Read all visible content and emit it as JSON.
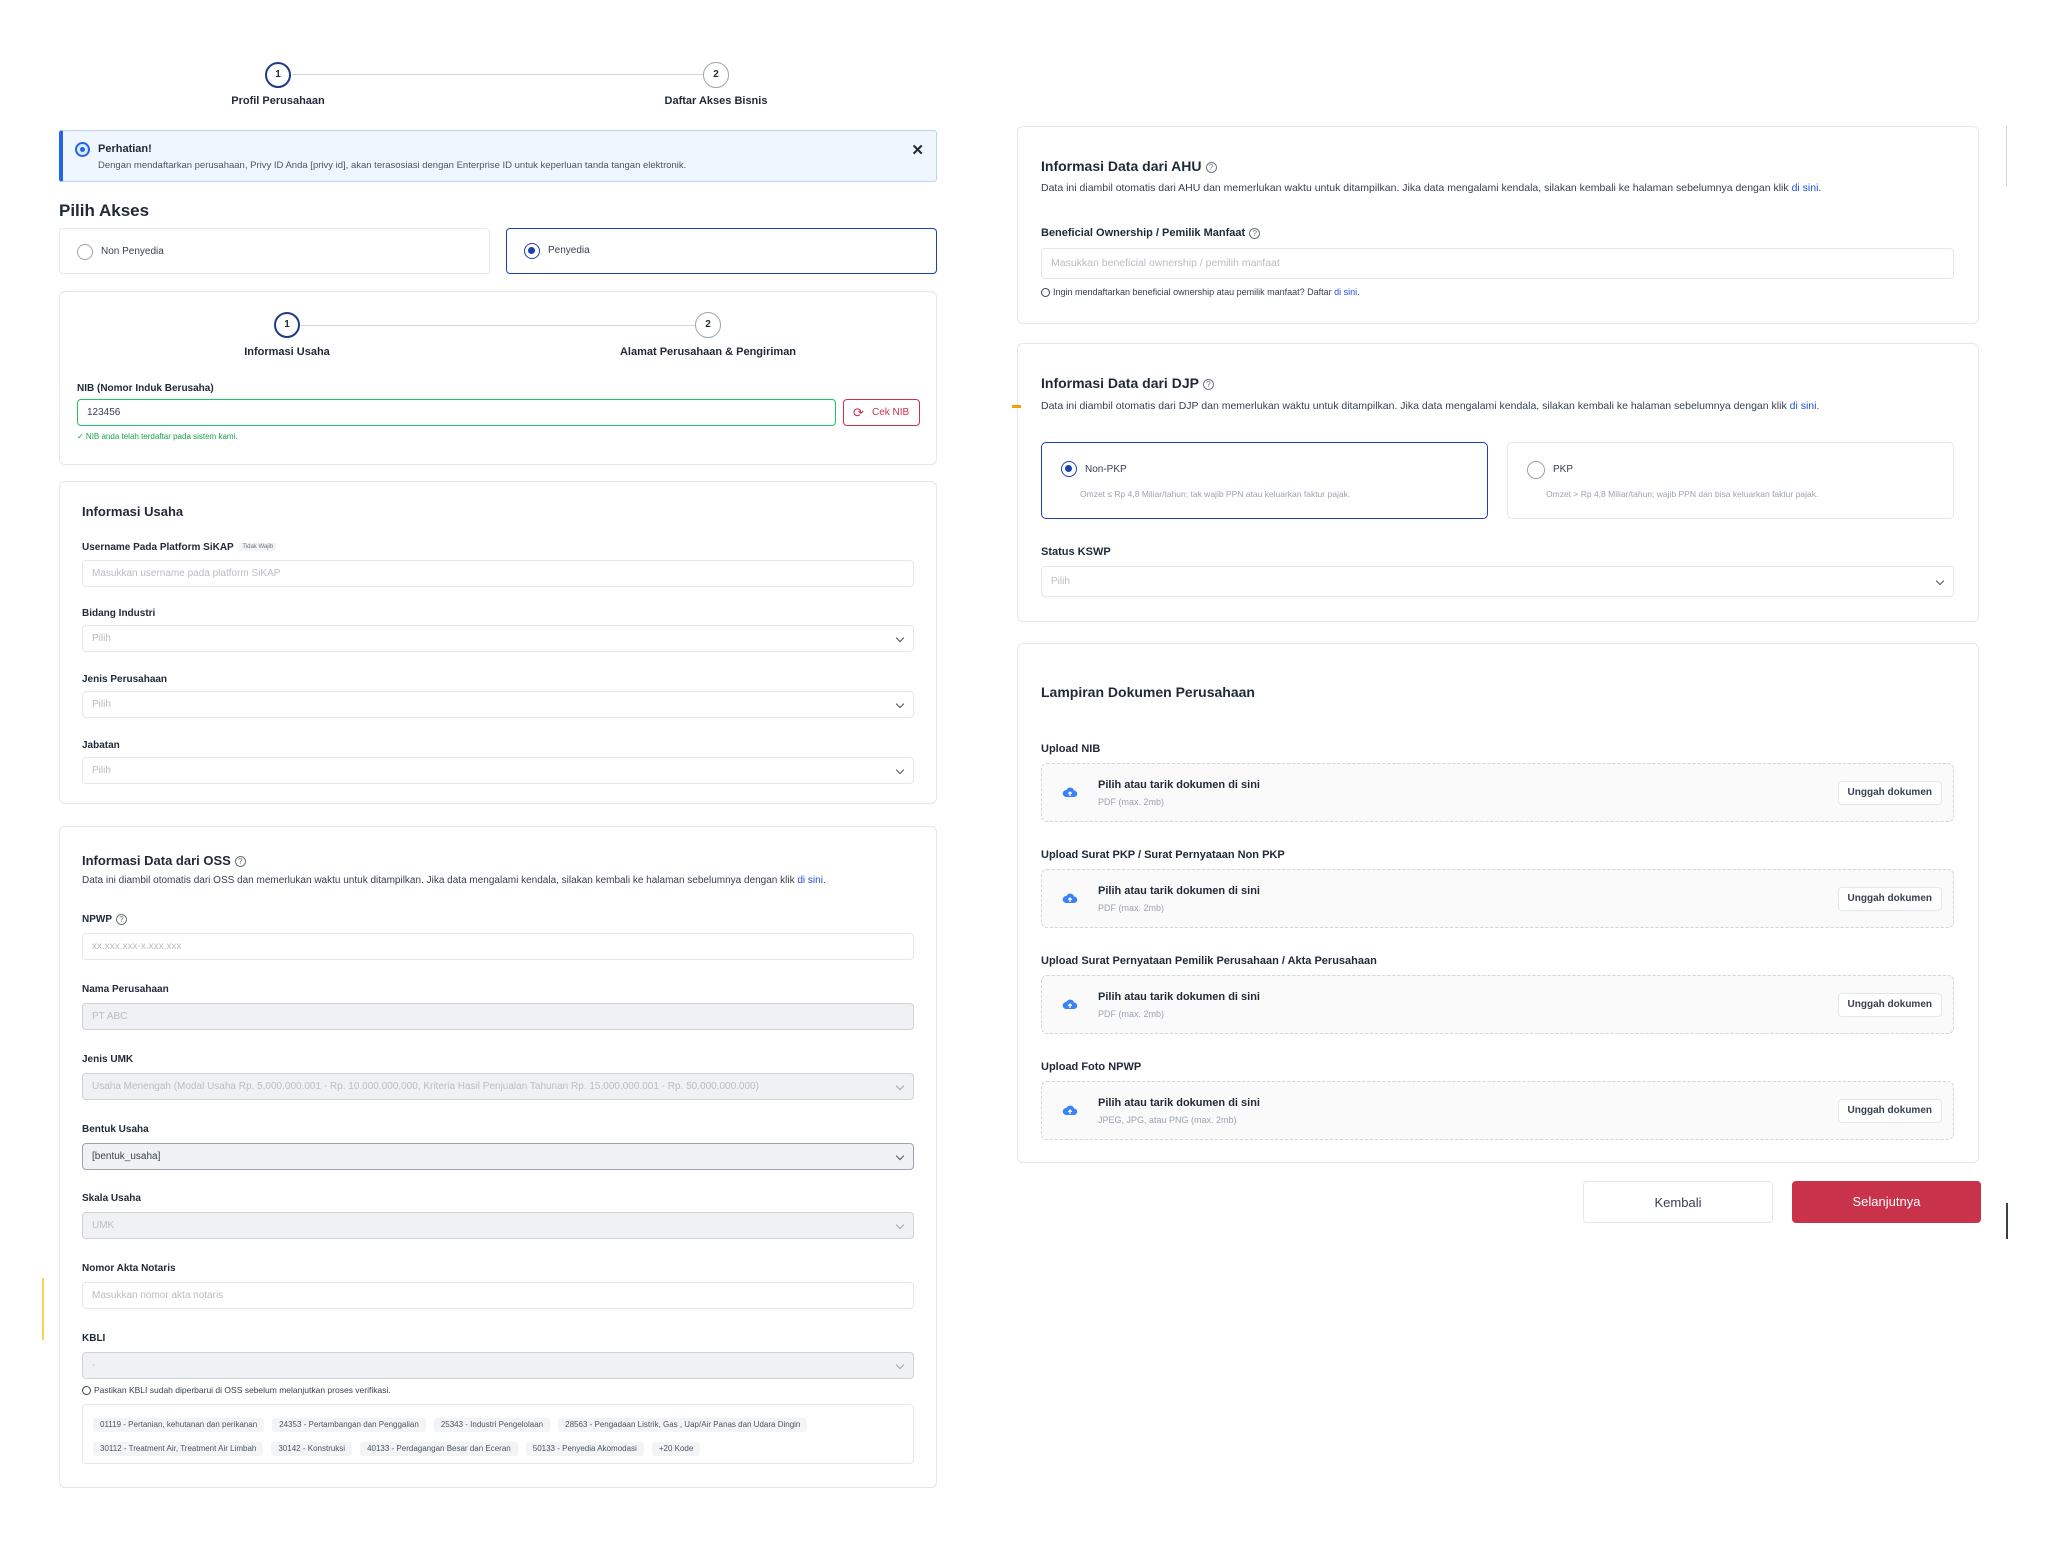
{
  "top_stepper": {
    "step1": "1",
    "step1_label": "Profil Perusahaan",
    "step2": "2",
    "step2_label": "Daftar Akses Bisnis"
  },
  "alert": {
    "title": "Perhatian!",
    "text": "Dengan mendaftarkan perusahaan, Privy ID Anda [privy id], akan terasosiasi dengan Enterprise ID untuk keperluan tanda tangan elektronik.",
    "close": "✕"
  },
  "access": {
    "title": "Pilih Akses",
    "option1": "Non Penyedia",
    "option2": "Penyedia",
    "selected": "Penyedia"
  },
  "inner_stepper": {
    "step1": "1",
    "step1_label": "Informasi Usaha",
    "step2": "2",
    "step2_label": "Alamat Perusahaan & Pengiriman"
  },
  "nib": {
    "label": "NIB (Nomor Induk Berusaha)",
    "value": "123456",
    "check_button": "Cek NIB",
    "success": "✓ NIB anda telah terdaftar pada sistem kami."
  },
  "usaha": {
    "title": "Informasi Usaha",
    "username_label": "Username Pada Platform SiKAP",
    "username_badge": "Tidak Wajib",
    "username_placeholder": "Masukkan username pada platform SiKAP",
    "bidang_label": "Bidang Industri",
    "bidang_placeholder": "Pilih",
    "jenis_label": "Jenis Perusahaan",
    "jenis_placeholder": "Pilih",
    "jabatan_label": "Jabatan",
    "jabatan_placeholder": "Pilih"
  },
  "oss": {
    "title": "Informasi Data dari OSS",
    "help": "?",
    "desc": "Data ini diambil otomatis dari OSS dan memerlukan waktu untuk ditampilkan. Jika data mengalami kendala, silakan kembali ke halaman sebelumnya dengan klik ",
    "desc_link": "di sini",
    "desc_end": ".",
    "npwp_label": "NPWP",
    "npwp_placeholder": "xx.xxx.xxx-x.xxx.xxx",
    "nama_label": "Nama Perusahaan",
    "nama_value": "PT ABC",
    "umk_label": "Jenis UMK",
    "umk_value": "Usaha Menengah (Modal Usaha Rp. 5.000.000.001 - Rp. 10.000.000.000, Kriteria Hasil Penjualan Tahunan Rp. 15.000.000.001 - Rp. 50.000.000.000)",
    "bentuk_label": "Bentuk Usaha",
    "bentuk_value": "[bentuk_usaha]",
    "skala_label": "Skala Usaha",
    "skala_value": "UMK",
    "akta_label": "Nomor Akta Notaris",
    "akta_placeholder": "Masukkan nomor akta notaris",
    "kbli_label": "KBLI",
    "kbli_value": "-",
    "kbli_note": "Pastikan KBLI sudah diperbarui di OSS sebelum melanjutkan proses verifikasi.",
    "kbli_chips": [
      "01119 - Pertanian, kehutanan dan perikanan",
      "24353 - Pertambangan dan Penggalian",
      "25343 - Industri Pengelolaan",
      "28563 - Pengadaan Listrik, Gas , Uap/Air Panas dan Udara Dingin",
      "30112 - Treatment Air, Treatment Air Limbah",
      "30142 - Konstruksi",
      "40133 - Perdagangan Besar dan Eceran",
      "50133 - Penyedia Akomodasi",
      "+20 Kode"
    ]
  },
  "ahu": {
    "title": "Informasi Data dari AHU",
    "desc": "Data ini diambil otomatis dari AHU dan memerlukan waktu untuk ditampilkan. Jika data mengalami kendala, silakan kembali ke halaman sebelumnya dengan klik ",
    "desc_link": "di sini",
    "desc_end": ".",
    "bo_label": "Beneficial Ownership / Pemilik Manfaat",
    "bo_placeholder": "Masukkan beneficial ownership / pemilih manfaat",
    "bo_note": "Ingin mendaftarkan beneficial ownership atau pemilik manfaat? Daftar ",
    "bo_note_link": "di sini",
    "bo_note_end": "."
  },
  "djp": {
    "title": "Informasi Data dari DJP",
    "desc": "Data ini diambil otomatis dari DJP dan memerlukan waktu untuk ditampilkan. Jika data mengalami kendala, silakan kembali ke halaman sebelumnya dengan klik ",
    "desc_link": "di sini",
    "desc_end": ".",
    "opt1_title": "Non-PKP",
    "opt1_desc": "Omzet ≤ Rp 4,8 Miliar/tahun; tak wajib PPN atau keluarkan faktur pajak.",
    "opt2_title": "PKP",
    "opt2_desc": "Omzet > Rp 4,8 Miliar/tahun; wajib PPN dan bisa keluarkan faktur pajak.",
    "selected": "Non-PKP",
    "kswp_label": "Status KSWP",
    "kswp_placeholder": "Pilih"
  },
  "lampiran": {
    "title": "Lampiran Dokumen Perusahaan",
    "items": [
      {
        "label": "Upload NIB",
        "title": "Pilih atau tarik dokumen di sini",
        "hint": "PDF (max. 2mb)",
        "button": "Unggah dokumen"
      },
      {
        "label": "Upload Surat PKP / Surat Pernyataan Non PKP",
        "title": "Pilih atau tarik dokumen di sini",
        "hint": "PDF (max. 2mb)",
        "button": "Unggah dokumen"
      },
      {
        "label": "Upload Surat Pernyataan Pemilik Perusahaan / Akta Perusahaan",
        "title": "Pilih atau tarik dokumen di sini",
        "hint": "PDF (max. 2mb)",
        "button": "Unggah dokumen"
      },
      {
        "label": "Upload Foto NPWP",
        "title": "Pilih atau tarik dokumen di sini",
        "hint": "JPEG, JPG, atau PNG (max. 2mb)",
        "button": "Unggah dokumen"
      }
    ]
  },
  "actions": {
    "back": "Kembali",
    "next": "Selanjutnya"
  },
  "colors": {
    "primary": "#c8324a",
    "accent": "#1e40af",
    "success": "#16a34a",
    "info_bg": "#f0f6ff"
  }
}
